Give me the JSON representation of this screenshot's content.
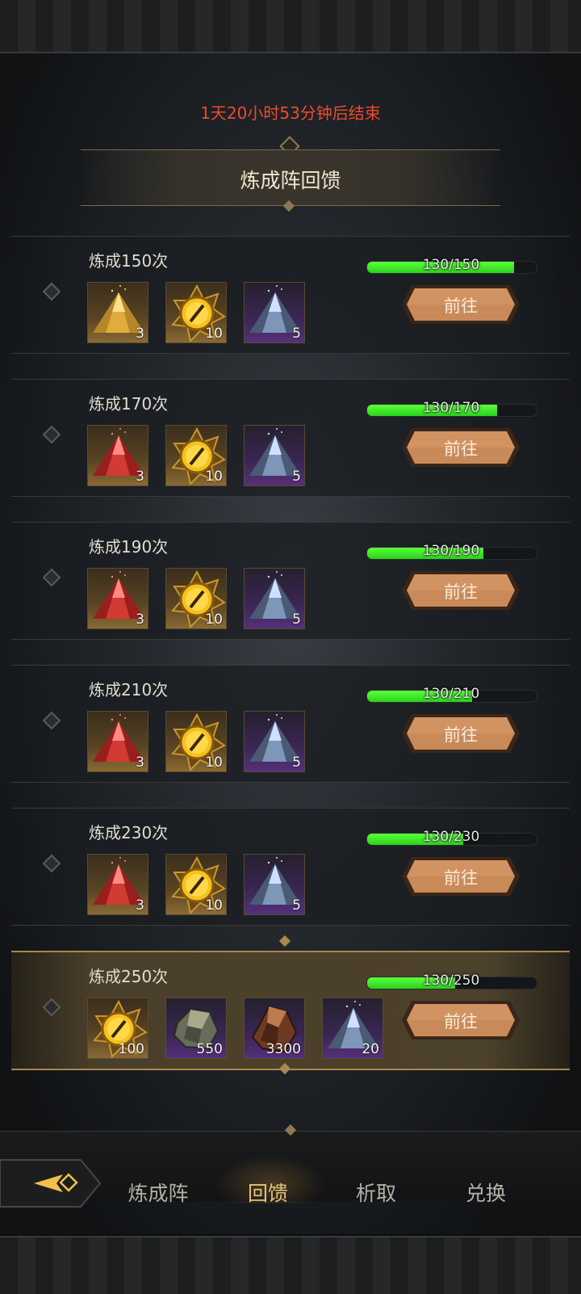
{
  "timer": "1天20小时53分钟后结束",
  "title": "炼成阵回馈",
  "go_label": "前往",
  "rows": [
    {
      "label": "炼成150次",
      "progress": "130/150",
      "fraction": 0.867,
      "items": [
        {
          "icon": "gold-powder-icon",
          "frame": "gold",
          "count": "3"
        },
        {
          "icon": "golden-eye-medallion-icon",
          "frame": "gold",
          "count": "10"
        },
        {
          "icon": "blue-powder-icon",
          "frame": "purple",
          "count": "5"
        }
      ]
    },
    {
      "label": "炼成170次",
      "progress": "130/170",
      "fraction": 0.765,
      "items": [
        {
          "icon": "red-powder-icon",
          "frame": "gold",
          "count": "3"
        },
        {
          "icon": "golden-eye-medallion-icon",
          "frame": "gold",
          "count": "10"
        },
        {
          "icon": "blue-powder-icon",
          "frame": "purple",
          "count": "5"
        }
      ]
    },
    {
      "label": "炼成190次",
      "progress": "130/190",
      "fraction": 0.684,
      "items": [
        {
          "icon": "red-powder-icon",
          "frame": "gold",
          "count": "3"
        },
        {
          "icon": "golden-eye-medallion-icon",
          "frame": "gold",
          "count": "10"
        },
        {
          "icon": "blue-powder-icon",
          "frame": "purple",
          "count": "5"
        }
      ]
    },
    {
      "label": "炼成210次",
      "progress": "130/210",
      "fraction": 0.619,
      "items": [
        {
          "icon": "red-powder-icon",
          "frame": "gold",
          "count": "3"
        },
        {
          "icon": "golden-eye-medallion-icon",
          "frame": "gold",
          "count": "10"
        },
        {
          "icon": "blue-powder-icon",
          "frame": "purple",
          "count": "5"
        }
      ]
    },
    {
      "label": "炼成230次",
      "progress": "130/230",
      "fraction": 0.565,
      "items": [
        {
          "icon": "red-powder-icon",
          "frame": "gold",
          "count": "3"
        },
        {
          "icon": "golden-eye-medallion-icon",
          "frame": "gold",
          "count": "10"
        },
        {
          "icon": "blue-powder-icon",
          "frame": "purple",
          "count": "5"
        }
      ]
    },
    {
      "label": "炼成250次",
      "progress": "130/250",
      "fraction": 0.52,
      "items": [
        {
          "icon": "golden-eye-medallion-icon",
          "frame": "gold",
          "count": "100"
        },
        {
          "icon": "ore-chunk-icon",
          "frame": "purple",
          "count": "550"
        },
        {
          "icon": "brown-stone-icon",
          "frame": "purple",
          "count": "3300"
        },
        {
          "icon": "blue-powder-icon",
          "frame": "purple",
          "count": "20"
        }
      ]
    }
  ],
  "tabs": [
    {
      "label": "炼成阵",
      "active": false
    },
    {
      "label": "回馈",
      "active": true
    },
    {
      "label": "析取",
      "active": false
    },
    {
      "label": "兑换",
      "active": false
    }
  ],
  "colors": {
    "timer": "#ef4a2e",
    "progress_fill": "#3ee82a",
    "button": "#c98a5a",
    "active_tab": "#e8c47a"
  }
}
